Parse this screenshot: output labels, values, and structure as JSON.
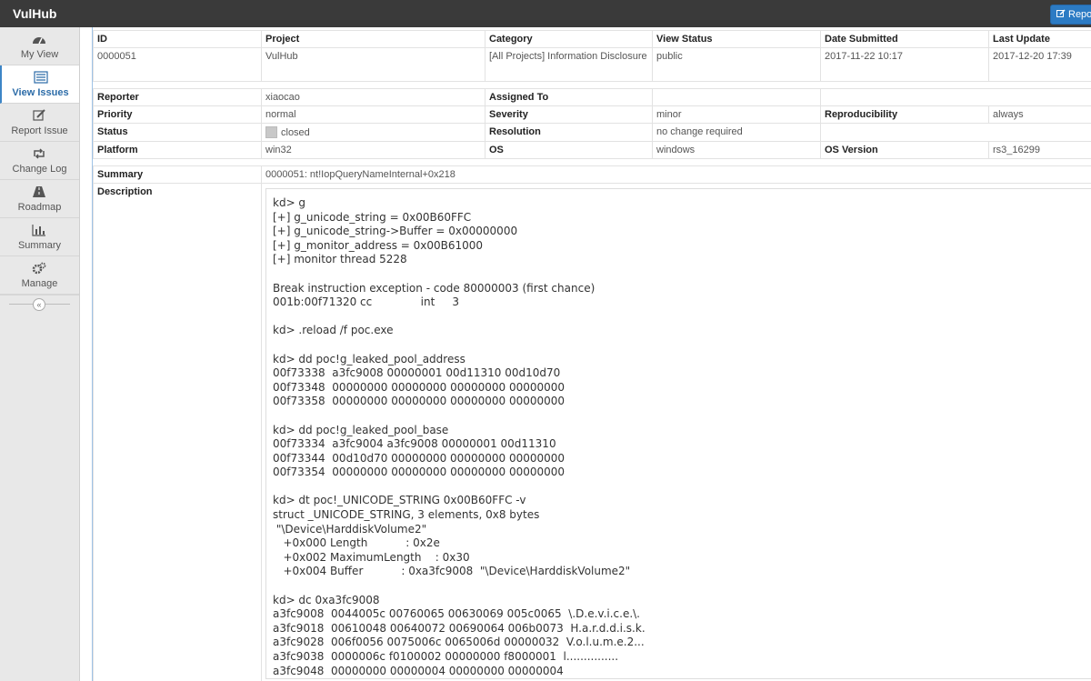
{
  "app": {
    "brand": "VulHub",
    "report_button": "Repo"
  },
  "sidebar": {
    "items": [
      {
        "label": "My View",
        "icon": "dashboard-icon"
      },
      {
        "label": "View Issues",
        "icon": "list-icon",
        "active": true
      },
      {
        "label": "Report Issue",
        "icon": "edit-icon"
      },
      {
        "label": "Change Log",
        "icon": "retweet-icon"
      },
      {
        "label": "Roadmap",
        "icon": "road-icon"
      },
      {
        "label": "Summary",
        "icon": "bar-chart-icon"
      },
      {
        "label": "Manage",
        "icon": "gears-icon"
      }
    ],
    "collapse_glyph": "«"
  },
  "issue": {
    "headers": {
      "id": "ID",
      "project": "Project",
      "category": "Category",
      "view_status": "View Status",
      "date_submitted": "Date Submitted",
      "last_update": "Last Update"
    },
    "values": {
      "id": "0000051",
      "project": "VulHub",
      "category": "[All Projects] Information Disclosure",
      "view_status": "public",
      "date_submitted": "2017-11-22 10:17",
      "last_update": "2017-12-20 17:39"
    },
    "fields": {
      "reporter_label": "Reporter",
      "reporter": "xiaocao",
      "assigned_label": "Assigned To",
      "assigned": "",
      "priority_label": "Priority",
      "priority": "normal",
      "severity_label": "Severity",
      "severity": "minor",
      "reproducibility_label": "Reproducibility",
      "reproducibility": "always",
      "status_label": "Status",
      "status": "closed",
      "status_color": "#c8c8c8",
      "resolution_label": "Resolution",
      "resolution": "no change required",
      "platform_label": "Platform",
      "platform": "win32",
      "os_label": "OS",
      "os": "windows",
      "os_version_label": "OS Version",
      "os_version": "rs3_16299"
    },
    "summary_label": "Summary",
    "summary": "0000051: nt!IopQueryNameInternal+0x218",
    "description_label": "Description",
    "description": "kd> g\n[+] g_unicode_string = 0x00B60FFC\n[+] g_unicode_string->Buffer = 0x00000000\n[+] g_monitor_address = 0x00B61000\n[+] monitor thread 5228\n\nBreak instruction exception - code 80000003 (first chance)\n001b:00f71320 cc              int     3\n\nkd> .reload /f poc.exe\n\nkd> dd poc!g_leaked_pool_address\n00f73338  a3fc9008 00000001 00d11310 00d10d70\n00f73348  00000000 00000000 00000000 00000000\n00f73358  00000000 00000000 00000000 00000000\n\nkd> dd poc!g_leaked_pool_base\n00f73334  a3fc9004 a3fc9008 00000001 00d11310\n00f73344  00d10d70 00000000 00000000 00000000\n00f73354  00000000 00000000 00000000 00000000\n\nkd> dt poc!_UNICODE_STRING 0x00B60FFC -v\nstruct _UNICODE_STRING, 3 elements, 0x8 bytes\n \"\\Device\\HarddiskVolume2\"\n   +0x000 Length           : 0x2e\n   +0x002 MaximumLength    : 0x30\n   +0x004 Buffer           : 0xa3fc9008  \"\\Device\\HarddiskVolume2\"\n\nkd> dc 0xa3fc9008\na3fc9008  0044005c 00760065 00630069 005c0065  \\.D.e.v.i.c.e.\\.\na3fc9018  00610048 00640072 00690064 006b0073  H.a.r.d.d.i.s.k.\na3fc9028  006f0056 0075006c 0065006d 00000032  V.o.l.u.m.e.2...\na3fc9038  0000006c f0100002 00000000 f8000001  l...............\na3fc9048  00000000 00000004 00000000 00000004"
  }
}
